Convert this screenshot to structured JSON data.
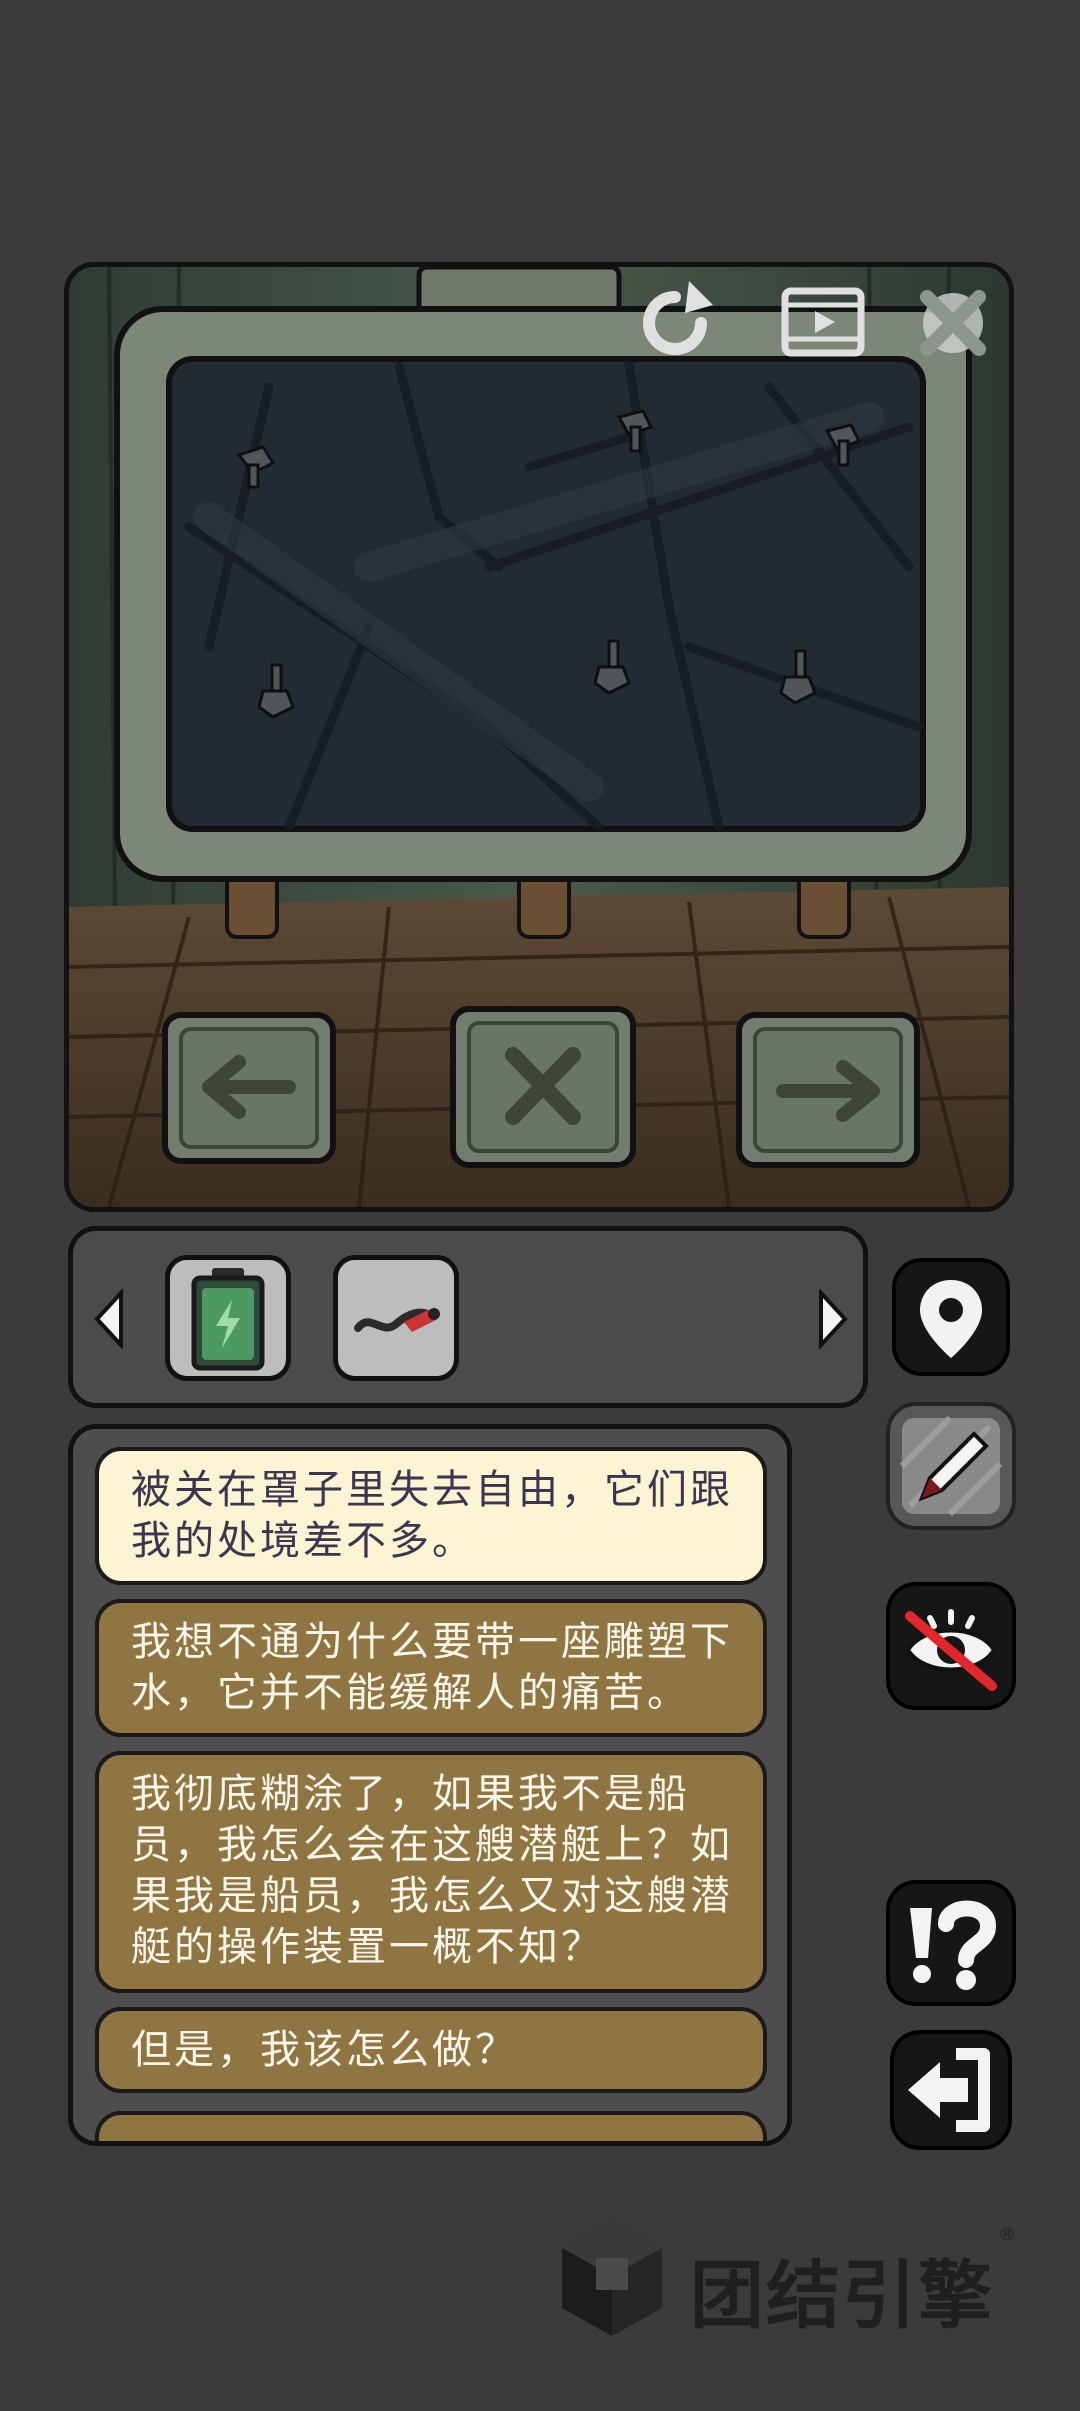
{
  "scene": {
    "top_icons": [
      "rewind-icon",
      "video-hint-icon",
      "settings-icon"
    ],
    "nav_buttons": [
      "left-arrow-icon",
      "close-x-icon",
      "right-arrow-icon"
    ]
  },
  "inventory": {
    "items": [
      {
        "name": "battery",
        "icon": "battery-icon"
      },
      {
        "name": "wire",
        "icon": "wire-icon"
      }
    ]
  },
  "dialogue": {
    "lines": [
      "被关在罩子里失去自由，它们跟我的处境差不多。",
      "我想不通为什么要带一座雕塑下水，它并不能缓解人的痛苦。",
      "我彻底糊涂了，如果我不是船员，我怎么会在这艘潜艇上？如果我是船员，我怎么又对这艘潜艇的操作装置一概不知？",
      "但是，我该怎么做？"
    ]
  },
  "side_buttons": [
    "map-pin-icon",
    "pencil-icon",
    "eye-hidden-icon",
    "hint-icon",
    "exit-icon"
  ],
  "watermark": {
    "text": "团结引擎",
    "mark": "®"
  },
  "colors": {
    "background": "#3b3b3b",
    "bubble_current": "#fdf4d3",
    "bubble_past": "#8e7541"
  }
}
